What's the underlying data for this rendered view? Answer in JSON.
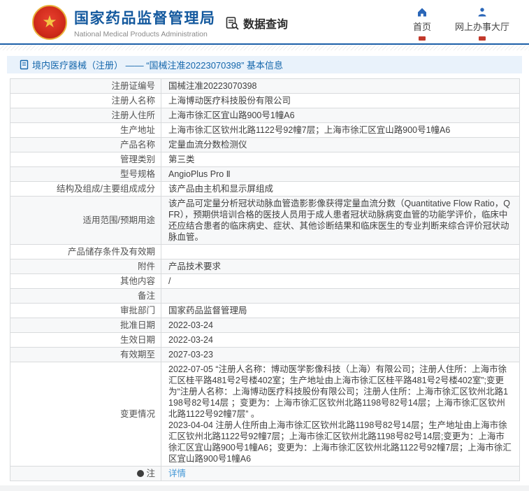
{
  "header": {
    "org_name_cn": "国家药品监督管理局",
    "org_name_en": "National Medical Products Administration",
    "data_query_label": "数据查询",
    "nav": [
      {
        "label": "首页",
        "icon": "home-icon"
      },
      {
        "label": "网上办事大厅",
        "icon": "person-icon"
      }
    ]
  },
  "breadcrumb": {
    "title": "境内医疗器械（注册） —— “国械注准20223070398” 基本信息"
  },
  "colors": {
    "brand_blue": "#14599e",
    "titlebar_bg": "#e9f2fb",
    "titlebar_text": "#1567ac",
    "link_blue": "#4296d6",
    "emblem_red": "#cf2a1b",
    "emblem_gold": "#e9b23c"
  },
  "table": {
    "rows": [
      {
        "label": "注册证编号",
        "value": "国械注准20223070398"
      },
      {
        "label": "注册人名称",
        "value": "上海博动医疗科技股份有限公司"
      },
      {
        "label": "注册人住所",
        "value": "上海市徐汇区宜山路900号1幢A6"
      },
      {
        "label": "生产地址",
        "value": "上海市徐汇区钦州北路1122号92幢7层；上海市徐汇区宜山路900号1幢A6"
      },
      {
        "label": "产品名称",
        "value": "定量血流分数检测仪"
      },
      {
        "label": "管理类别",
        "value": "第三类"
      },
      {
        "label": "型号规格",
        "value": "AngioPlus Pro Ⅱ"
      },
      {
        "label": "结构及组成/主要组成成分",
        "value": "该产品由主机和显示屏组成"
      },
      {
        "label": "适用范围/预期用途",
        "value": "该产品可定量分析冠状动脉血管造影影像获得定量血流分数（Quantitative Flow Ratio，QFR），预期供培训合格的医技人员用于成人患者冠状动脉病变血管的功能学评价，临床中还应结合患者的临床病史、症状、其他诊断结果和临床医生的专业判断来综合评价冠状动脉血管。"
      },
      {
        "label": "产品储存条件及有效期",
        "value": ""
      },
      {
        "label": "附件",
        "value": "产品技术要求"
      },
      {
        "label": "其他内容",
        "value": "/"
      },
      {
        "label": "备注",
        "value": ""
      },
      {
        "label": "审批部门",
        "value": "国家药品监督管理局"
      },
      {
        "label": "批准日期",
        "value": "2022-03-24"
      },
      {
        "label": "生效日期",
        "value": "2022-03-24"
      },
      {
        "label": "有效期至",
        "value": "2027-03-23"
      },
      {
        "label": "变更情况",
        "multiline": true,
        "value": "2022-07-05  “注册人名称：博动医学影像科技（上海）有限公司；注册人住所：上海市徐汇区桂平路481号2号楼402室；生产地址由上海市徐汇区桂平路481号2号楼402室”;变更为“注册人名称：上海博动医疗科技股份有限公司；注册人住所：上海市徐汇区钦州北路1198号82号14层 ；变更为：上海市徐汇区钦州北路1198号82号14层；上海市徐汇区钦州北路1122号92幢7层” 。\n2023-04-04 注册人住所由上海市徐汇区钦州北路1198号82号14层；生产地址由上海市徐汇区钦州北路1122号92幢7层；上海市徐汇区钦州北路1198号82号14层;变更为：上海市徐汇区宜山路900号1幢A6；变更为：上海市徐汇区钦州北路1122号92幢7层；上海市徐汇区宜山路900号1幢A6"
      },
      {
        "label": "注",
        "label_icon": "note-icon",
        "value": "详情",
        "value_is_link": true
      }
    ]
  }
}
